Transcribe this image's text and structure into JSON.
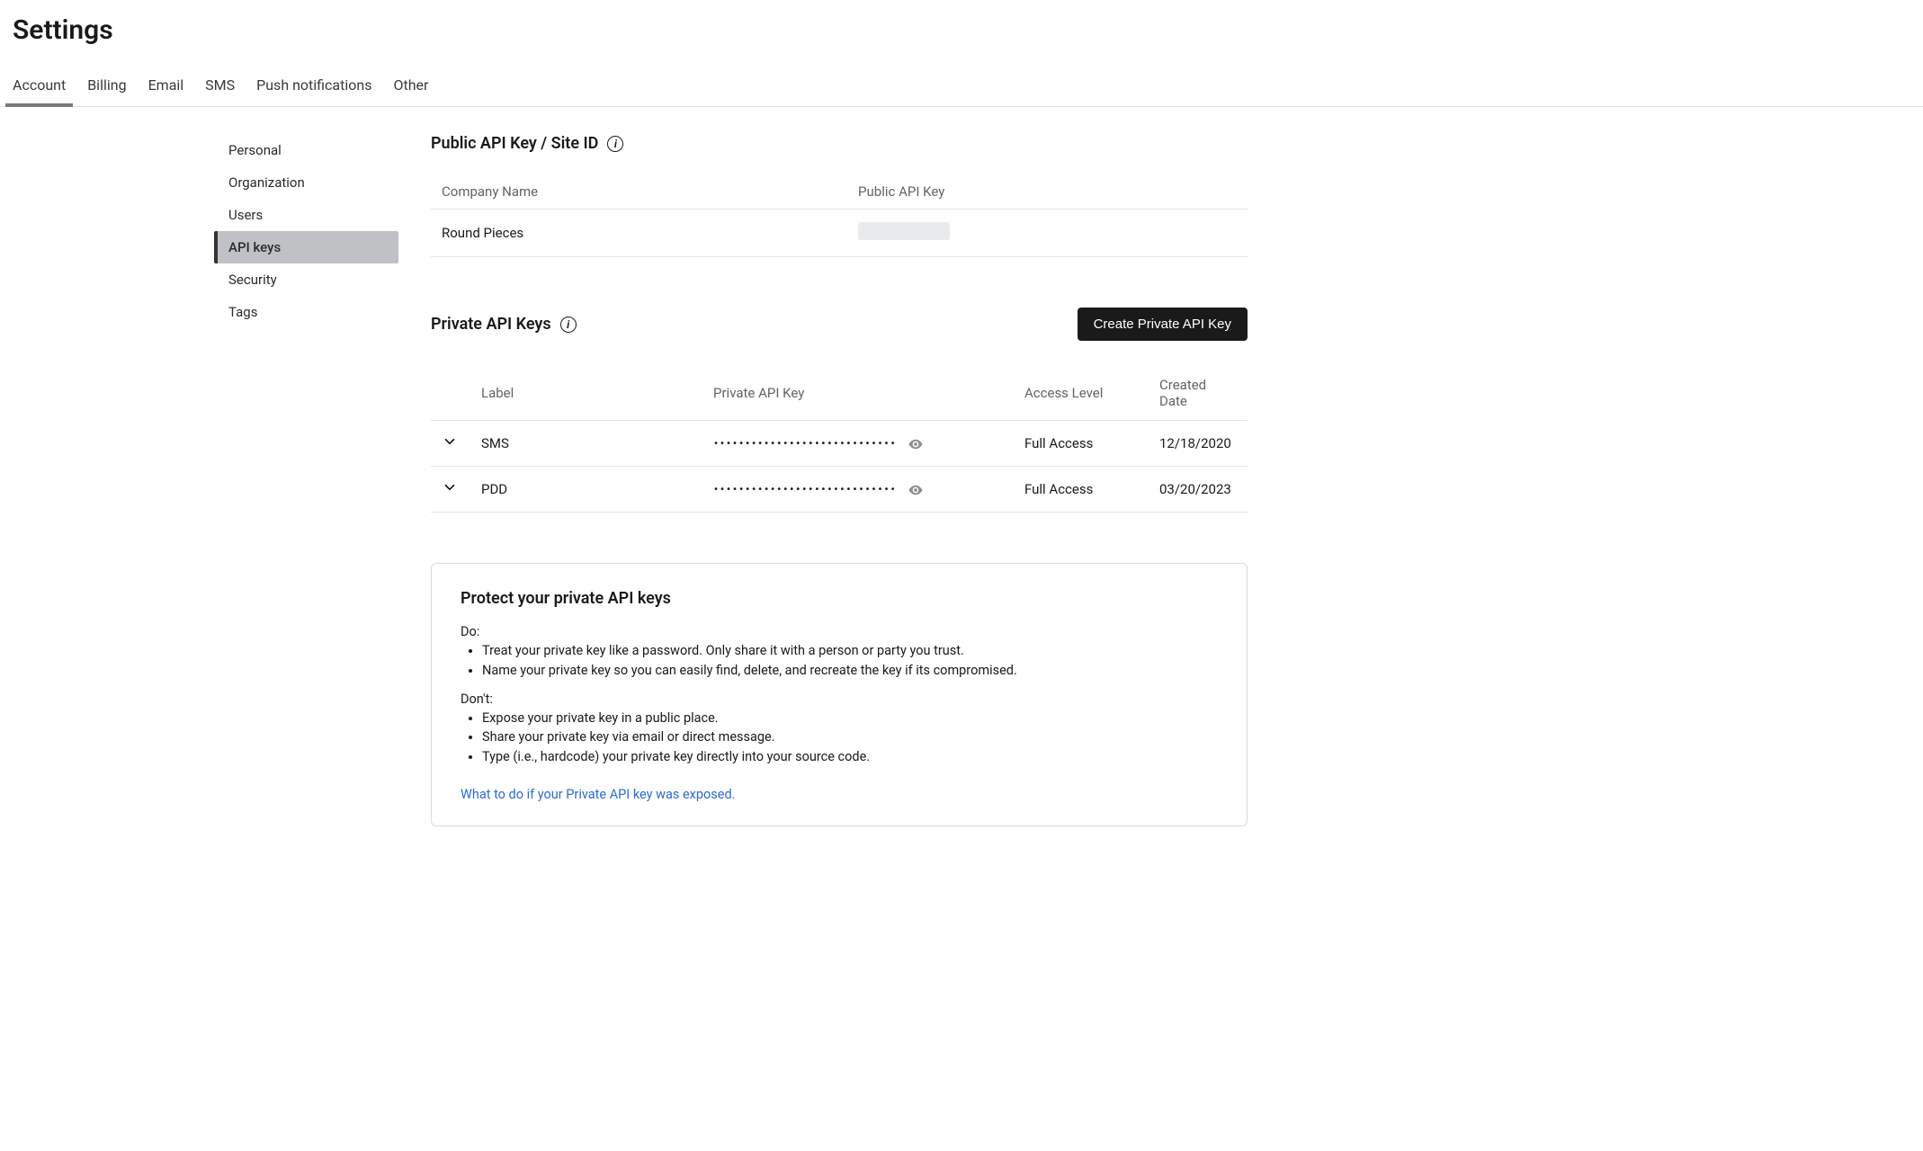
{
  "page_title": "Settings",
  "top_tabs": [
    {
      "label": "Account",
      "active": true
    },
    {
      "label": "Billing"
    },
    {
      "label": "Email"
    },
    {
      "label": "SMS"
    },
    {
      "label": "Push notifications"
    },
    {
      "label": "Other"
    }
  ],
  "sidebar_items": [
    {
      "label": "Personal"
    },
    {
      "label": "Organization"
    },
    {
      "label": "Users"
    },
    {
      "label": "API keys",
      "active": true
    },
    {
      "label": "Security"
    },
    {
      "label": "Tags"
    }
  ],
  "public_section": {
    "title": "Public API Key / Site ID",
    "table_headers": {
      "company": "Company Name",
      "key": "Public API Key"
    },
    "rows": [
      {
        "company": "Round Pieces",
        "key_redacted": true
      }
    ]
  },
  "private_section": {
    "title": "Private API Keys",
    "create_button": "Create Private API Key",
    "table_headers": {
      "label": "Label",
      "key": "Private API Key",
      "access": "Access Level",
      "created": "Created Date"
    },
    "rows": [
      {
        "label": "SMS",
        "key_mask": "•••••••••••••••••••••••••••••",
        "access": "Full Access",
        "created": "12/18/2020"
      },
      {
        "label": "PDD",
        "key_mask": "•••••••••••••••••••••••••••••",
        "access": "Full Access",
        "created": "03/20/2023"
      }
    ]
  },
  "protect": {
    "title": "Protect your private API keys",
    "do_label": "Do:",
    "dont_label": "Don't:",
    "do_items": [
      "Treat your private key like a password. Only share it with a person or party you trust.",
      "Name your private key so you can easily find, delete, and recreate the key if its compromised."
    ],
    "dont_items": [
      "Expose your private key in a public place.",
      "Share your private key via email or direct message.",
      "Type (i.e., hardcode) your private key directly into your source code."
    ],
    "link": "What to do if your Private API key was exposed."
  }
}
